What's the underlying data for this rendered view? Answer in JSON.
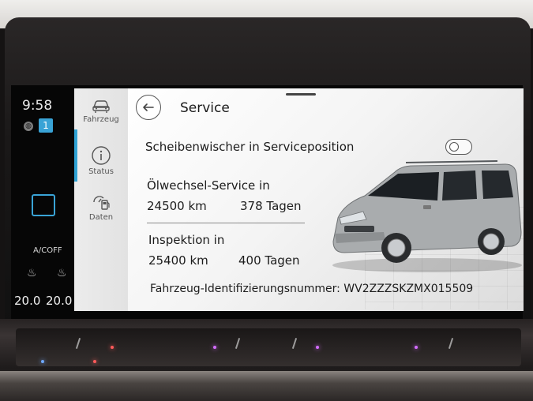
{
  "status_bar": {
    "time": "9:58",
    "notification_count": "1",
    "ac_label": "A/COFF",
    "temp_left": "20.0",
    "temp_right": "20.0"
  },
  "nav": {
    "items": [
      {
        "label": "Fahrzeug",
        "icon": "car-icon",
        "active": false
      },
      {
        "label": "Status",
        "icon": "info-icon",
        "active": true
      },
      {
        "label": "Daten",
        "icon": "fuel-data-icon",
        "active": false
      }
    ]
  },
  "page": {
    "title": "Service",
    "wiper_label": "Scheibenwischer in Serviceposition",
    "wiper_toggle_on": false,
    "oil_title": "Ölwechsel-Service in",
    "oil_km": "24500 km",
    "oil_days": "378 Tagen",
    "inspection_title": "Inspektion in",
    "inspection_km": "25400 km",
    "inspection_days": "400 Tagen",
    "vin_line": "Fahrzeug-Identifizierungsnummer: WV2ZZZSKZMX015509"
  },
  "colors": {
    "accent": "#2fa3d5",
    "background": "#f5f5f5"
  }
}
